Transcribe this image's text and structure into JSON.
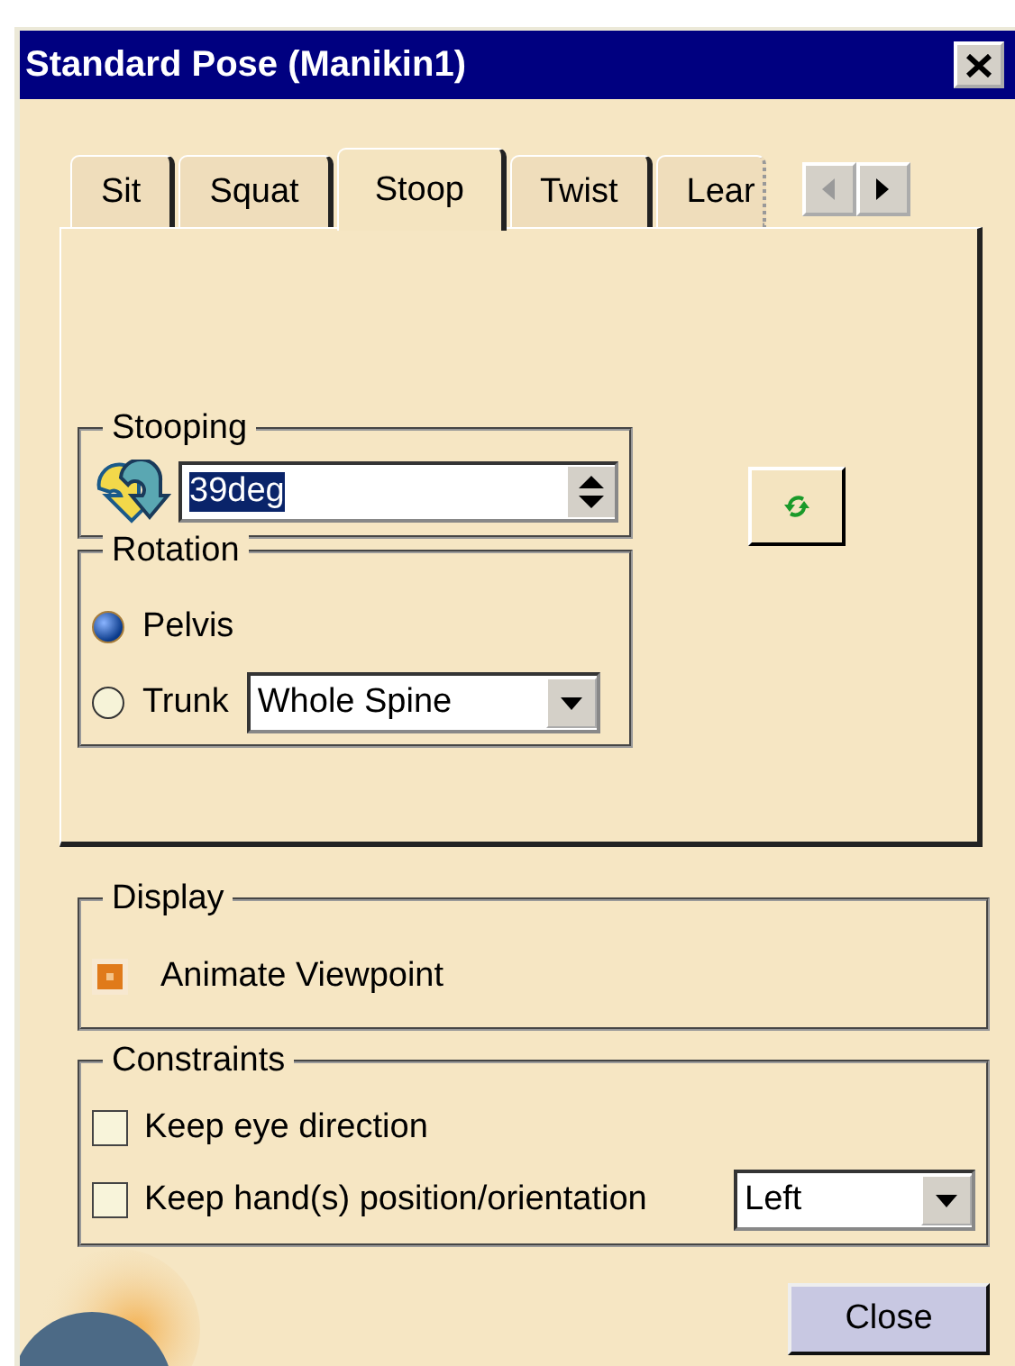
{
  "window": {
    "title": "Standard Pose (Manikin1)"
  },
  "tabs": [
    {
      "label": "Sit",
      "selected": false
    },
    {
      "label": "Squat",
      "selected": false
    },
    {
      "label": "Stoop",
      "selected": true
    },
    {
      "label": "Twist",
      "selected": false
    },
    {
      "label": "Lear",
      "selected": false
    }
  ],
  "stooping": {
    "label": "Stooping",
    "value": "39deg",
    "text_selected": true
  },
  "rotation": {
    "label": "Rotation",
    "options": [
      {
        "label": "Pelvis",
        "selected": true
      },
      {
        "label": "Trunk",
        "selected": false,
        "choice": "Whole Spine"
      }
    ]
  },
  "display": {
    "label": "Display",
    "options": [
      {
        "label": "Animate Viewpoint",
        "checked": true
      }
    ]
  },
  "constraints": {
    "label": "Constraints",
    "options": [
      {
        "label": "Keep eye direction",
        "checked": false
      },
      {
        "label": "Keep hand(s) position/orientation",
        "checked": false,
        "choice": "Left"
      }
    ]
  },
  "buttons": [
    {
      "label": "Close"
    }
  ]
}
